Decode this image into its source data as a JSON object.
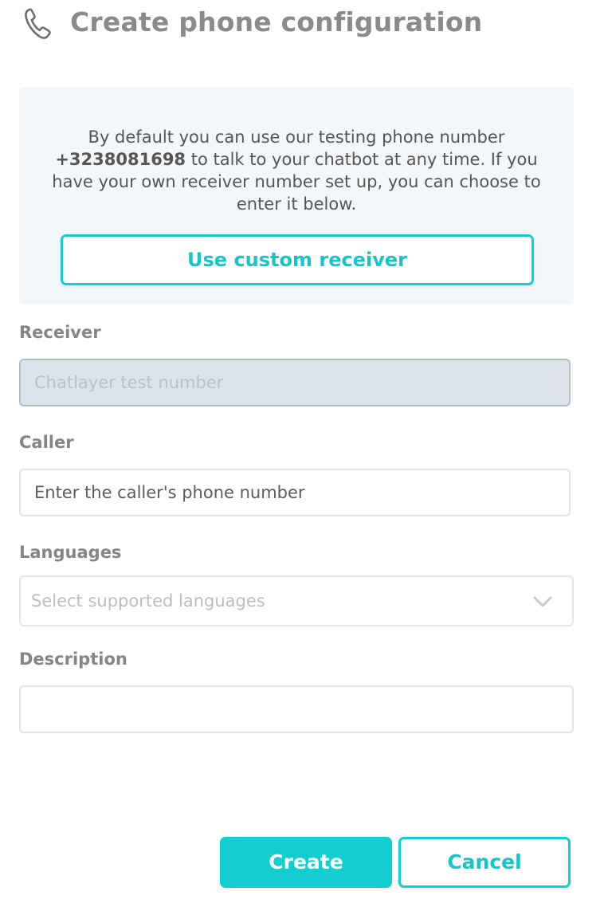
{
  "header": {
    "icon": "phone-icon",
    "title": "Create phone configuration"
  },
  "info": {
    "text_before": "By default you can use our testing phone number ",
    "phone_number": "+3238081698",
    "text_after": " to talk to your chatbot at any time. If you have your own receiver number set up, you can choose to enter it below.",
    "custom_receiver_label": "Use custom receiver"
  },
  "form": {
    "receiver": {
      "label": "Receiver",
      "placeholder": "Chatlayer test number"
    },
    "caller": {
      "label": "Caller",
      "placeholder": "Enter the caller's phone number"
    },
    "languages": {
      "label": "Languages",
      "placeholder": "Select supported languages",
      "icon": "chevron-down-icon"
    },
    "description": {
      "label": "Description",
      "value": ""
    }
  },
  "actions": {
    "create_label": "Create",
    "cancel_label": "Cancel"
  },
  "colors": {
    "accent": "#14cdd0",
    "title_gray": "#8a8a8a",
    "info_background": "#f4f7fa",
    "disabled_field": "#dde3ea"
  }
}
